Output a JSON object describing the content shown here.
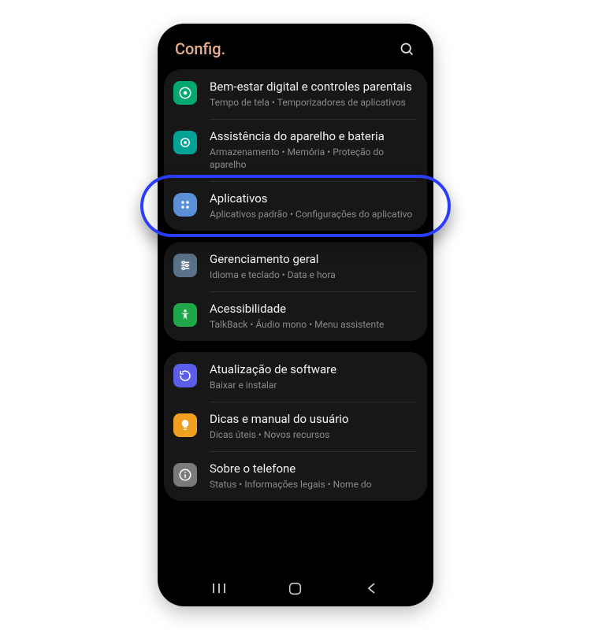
{
  "header": {
    "title": "Config."
  },
  "groups": [
    {
      "items": [
        {
          "id": "digital-wellbeing",
          "title": "Bem-estar digital e controles parentais",
          "sub": "Tempo de tela  •  Temporizadores de aplicativos",
          "icon": "heart-circle-icon",
          "bg": "bg-green1"
        },
        {
          "id": "device-care",
          "title": "Assistência do aparelho e bateria",
          "sub": "Armazenamento  •  Memória  •  Proteção do aparelho",
          "icon": "care-icon",
          "bg": "bg-teal"
        },
        {
          "id": "apps",
          "title": "Aplicativos",
          "sub": "Aplicativos padrão  •  Configurações do aplicativo",
          "icon": "apps-grid-icon",
          "bg": "bg-blue1",
          "highlighted": true
        }
      ]
    },
    {
      "items": [
        {
          "id": "general-management",
          "title": "Gerenciamento geral",
          "sub": "Idioma e teclado  •  Data e hora",
          "icon": "sliders-icon",
          "bg": "bg-slate"
        },
        {
          "id": "accessibility",
          "title": "Acessibilidade",
          "sub": "TalkBack  •  Áudio mono  •  Menu assistente",
          "icon": "accessibility-icon",
          "bg": "bg-green2"
        }
      ]
    },
    {
      "items": [
        {
          "id": "software-update",
          "title": "Atualização de software",
          "sub": "Baixar e instalar",
          "icon": "update-icon",
          "bg": "bg-indigo"
        },
        {
          "id": "tips",
          "title": "Dicas e manual do usuário",
          "sub": "Dicas úteis  •  Novos recursos",
          "icon": "bulb-icon",
          "bg": "bg-amber"
        },
        {
          "id": "about-phone",
          "title": "Sobre o telefone",
          "sub": "Status  •  Informações legais  •  Nome do",
          "icon": "info-icon",
          "bg": "bg-gray"
        }
      ]
    }
  ],
  "highlight_color": "#2a3cff"
}
